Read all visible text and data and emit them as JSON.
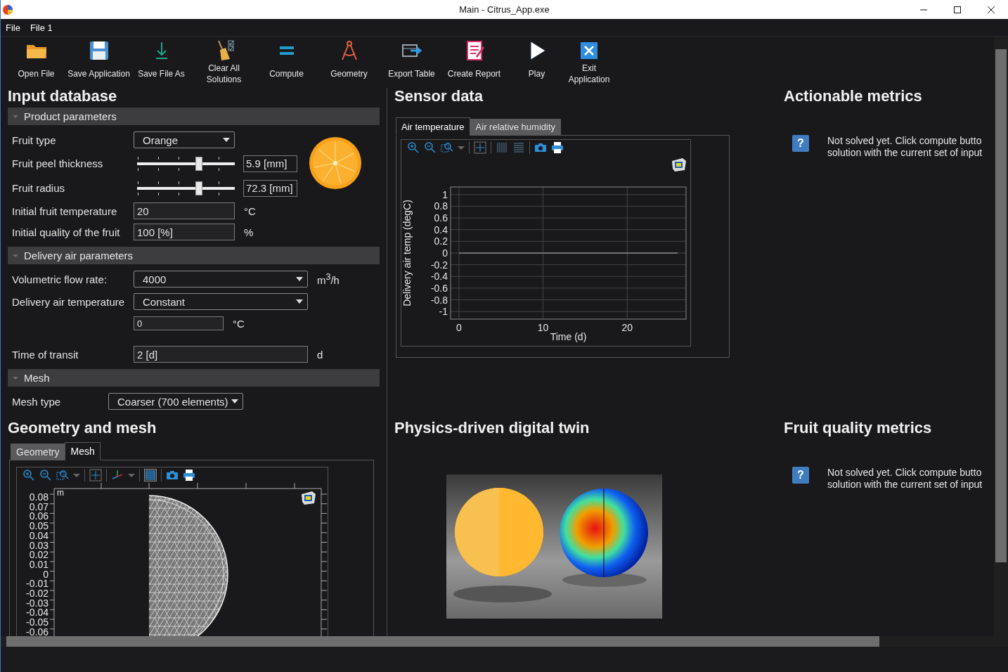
{
  "window": {
    "title": "Main - Citrus_App.exe"
  },
  "menu": [
    "File",
    "File 1"
  ],
  "toolbar": [
    {
      "kind": "open",
      "label": "Open File"
    },
    {
      "kind": "save",
      "label": "Save Application"
    },
    {
      "kind": "saveas",
      "label": "Save File As"
    },
    {
      "kind": "clear",
      "label": "Clear All Solutions"
    },
    {
      "kind": "compute",
      "label": "Compute"
    },
    {
      "kind": "geometry",
      "label": "Geometry"
    },
    {
      "kind": "export",
      "label": "Export Table"
    },
    {
      "kind": "report",
      "label": "Create Report"
    },
    {
      "kind": "play",
      "label": "Play"
    },
    {
      "kind": "exit",
      "label": "Exit Application"
    }
  ],
  "input_database": {
    "title": "Input database",
    "sections": [
      {
        "title": "Product parameters",
        "expanded": true,
        "rows": [
          {
            "kind": "dropdown",
            "label": "Fruit type",
            "value": "Orange"
          },
          {
            "kind": "slider",
            "label": "Fruit peel thickness",
            "level": 0.63,
            "value": "5.9 [mm]"
          },
          {
            "kind": "slider",
            "label": "Fruit radius",
            "level": 0.63,
            "value": "72.3 [mm]"
          },
          {
            "kind": "field",
            "label": "Initial fruit temperature",
            "value": "20",
            "unit": "°C"
          },
          {
            "kind": "field",
            "label": "Initial quality of the fruit",
            "value": "100 [%]",
            "unit": "%"
          }
        ]
      },
      {
        "title": "Delivery air parameters",
        "expanded": true,
        "rows": [
          {
            "kind": "dropdown",
            "label": "Volumetric flow rate:",
            "value": "4000",
            "unit": "m$^{3}$/h"
          },
          {
            "kind": "dropdown",
            "label": "Delivery air temperature",
            "value": "Constant"
          },
          {
            "kind": "field",
            "value": "0",
            "unit": "°C"
          },
          {
            "kind": "field",
            "label": "Time of transit",
            "value": "2 [d]",
            "unit": "d"
          }
        ]
      },
      {
        "title": "Mesh",
        "expanded": true,
        "rows": [
          {
            "kind": "dropdown",
            "label": "Mesh type",
            "value": "Coarser (700 elements)"
          }
        ]
      }
    ]
  },
  "sensor_data": {
    "title": "Sensor data",
    "tabs": [
      {
        "label": "Air temperature",
        "selected": true
      },
      {
        "label": "Air relative humidity",
        "selected": false
      }
    ],
    "chart_data": {
      "type": "line",
      "xlabel": "Time (d)",
      "ylabel": "Delivery air temp (degC)",
      "x": [
        0,
        26
      ],
      "series": [
        {
          "color": "#b4b4b4",
          "values": [
            0,
            0
          ]
        }
      ],
      "grid": true,
      "xlim": [
        -1,
        27
      ],
      "ylim": [
        -1.13,
        1.13
      ],
      "xticks": [
        0,
        10,
        20
      ],
      "yticks": [
        1,
        0.8,
        0.6,
        0.4,
        0.2,
        0,
        -0.2,
        -0.4,
        -0.6,
        -0.8,
        -1
      ]
    }
  },
  "actionable_metrics": {
    "title": "Actionable metrics",
    "help_icon": "?",
    "message_lines": [
      "Not solved yet. Click compute butto",
      "solution with the current set of input"
    ]
  },
  "geometry_and_mesh": {
    "title": "Geometry and mesh",
    "tabs": [
      {
        "label": "Geometry",
        "selected": false
      },
      {
        "label": "Mesh",
        "selected": true
      }
    ],
    "plot": {
      "unit": "m",
      "y_labels": [
        "0.08",
        "0.07",
        "0.06",
        "0.05",
        "0.04",
        "0.03",
        "0.02",
        "0.01",
        "0",
        "-0.01",
        "-0.02",
        "-0.03",
        "-0.04",
        "-0.05",
        "-0.06"
      ]
    }
  },
  "digital_twin": {
    "title": "Physics-driven digital twin"
  },
  "fruit_quality_metrics": {
    "title": "Fruit quality metrics",
    "help_icon": "?",
    "message_lines": [
      "Not solved yet. Click compute butto",
      "solution with the current set of input"
    ]
  }
}
